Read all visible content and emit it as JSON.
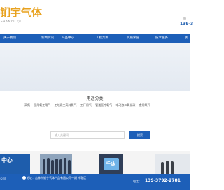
{
  "header": {
    "logo_text": "钔宇气体",
    "logo_sub": "SHANYU QITI",
    "small_text": "服",
    "phone": "139-3"
  },
  "nav": {
    "items": [
      {
        "label": "关于我们"
      },
      {
        "label": "新闻资讯"
      },
      {
        "label": "产品中心"
      },
      {
        "label": "工程案例"
      },
      {
        "label": "资质荣誉"
      },
      {
        "label": "技术服务"
      },
      {
        "label": "联"
      }
    ]
  },
  "category": {
    "title": "用途分类",
    "items": [
      "高氮",
      "医用氧工用气",
      "工地建工高纯氮气",
      "工厂用气",
      "管道医疗氧气",
      "电动液二氧化碳",
      "食用氧气"
    ]
  },
  "search": {
    "placeholder": "输入关键词",
    "button_label": "搜索"
  },
  "products": {
    "p1_text": "中心",
    "p3_text": "千冰"
  },
  "footer": {
    "left": "公司",
    "address": "地址：吉林市钔宇气体产品有限公司一期 市辖区",
    "tel_label": "电话：",
    "tel": "139-3792-2781"
  },
  "colors": {
    "brand_blue": "#1d5fb8",
    "logo_orange": "#e8a21f"
  }
}
